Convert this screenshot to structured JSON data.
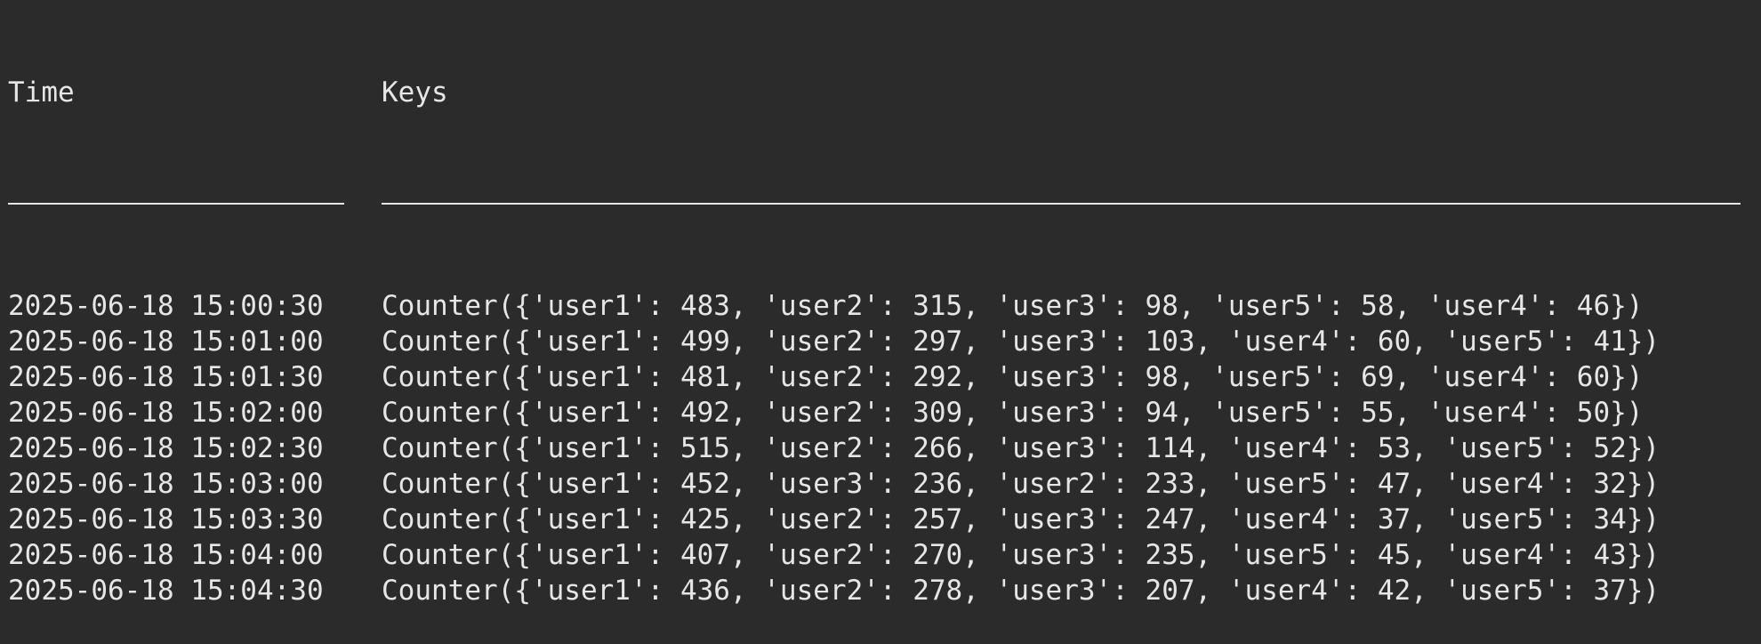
{
  "columns": {
    "time": "Time",
    "keys": "Keys"
  },
  "rows": [
    {
      "time": "2025-06-18 15:00:30",
      "keys": "Counter({'user1': 483, 'user2': 315, 'user3': 98, 'user5': 58, 'user4': 46})"
    },
    {
      "time": "2025-06-18 15:01:00",
      "keys": "Counter({'user1': 499, 'user2': 297, 'user3': 103, 'user4': 60, 'user5': 41})"
    },
    {
      "time": "2025-06-18 15:01:30",
      "keys": "Counter({'user1': 481, 'user2': 292, 'user3': 98, 'user5': 69, 'user4': 60})"
    },
    {
      "time": "2025-06-18 15:02:00",
      "keys": "Counter({'user1': 492, 'user2': 309, 'user3': 94, 'user5': 55, 'user4': 50})"
    },
    {
      "time": "2025-06-18 15:02:30",
      "keys": "Counter({'user1': 515, 'user2': 266, 'user3': 114, 'user4': 53, 'user5': 52})"
    },
    {
      "time": "2025-06-18 15:03:00",
      "keys": "Counter({'user1': 452, 'user3': 236, 'user2': 233, 'user5': 47, 'user4': 32})"
    },
    {
      "time": "2025-06-18 15:03:30",
      "keys": "Counter({'user1': 425, 'user2': 257, 'user3': 247, 'user4': 37, 'user5': 34})"
    },
    {
      "time": "2025-06-18 15:04:00",
      "keys": "Counter({'user1': 407, 'user2': 270, 'user3': 235, 'user5': 45, 'user4': 43})"
    },
    {
      "time": "2025-06-18 15:04:30",
      "keys": "Counter({'user1': 436, 'user2': 278, 'user3': 207, 'user4': 42, 'user5': 37})"
    }
  ]
}
